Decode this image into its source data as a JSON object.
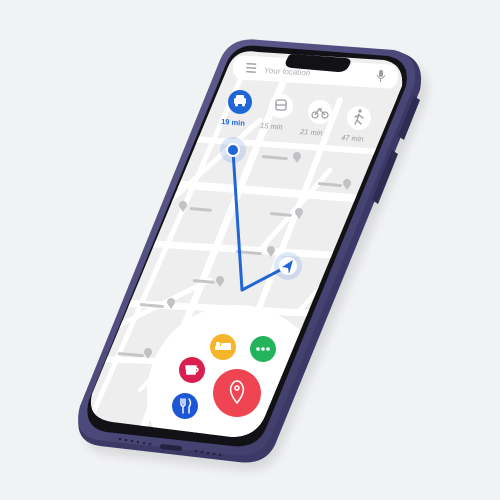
{
  "search": {
    "placeholder": "Your location"
  },
  "transport_modes": [
    {
      "mode": "car",
      "icon": "car-icon",
      "time": "19 min",
      "selected": true
    },
    {
      "mode": "transit",
      "icon": "bus-icon",
      "time": "15 min",
      "selected": false
    },
    {
      "mode": "bike",
      "icon": "bicycle-icon",
      "time": "21 min",
      "selected": false
    },
    {
      "mode": "walk",
      "icon": "walking-icon",
      "time": "47 min",
      "selected": false
    }
  ],
  "quick_actions": [
    {
      "name": "hotel",
      "icon": "bed-icon",
      "color": "#f6b42a"
    },
    {
      "name": "more",
      "icon": "more-dots-icon",
      "color": "#22b35b"
    },
    {
      "name": "cafe",
      "icon": "coffee-cup-icon",
      "color": "#d81f4f"
    },
    {
      "name": "restaurant",
      "icon": "fork-knife-icon",
      "color": "#1e57d6"
    },
    {
      "name": "pin",
      "icon": "location-pin-icon",
      "color": "#ef4452"
    }
  ],
  "colors": {
    "route": "#1f66d6",
    "accent": "#1f66d6",
    "phone_frame": "#4a4775",
    "map_bg": "#eeeeef"
  }
}
